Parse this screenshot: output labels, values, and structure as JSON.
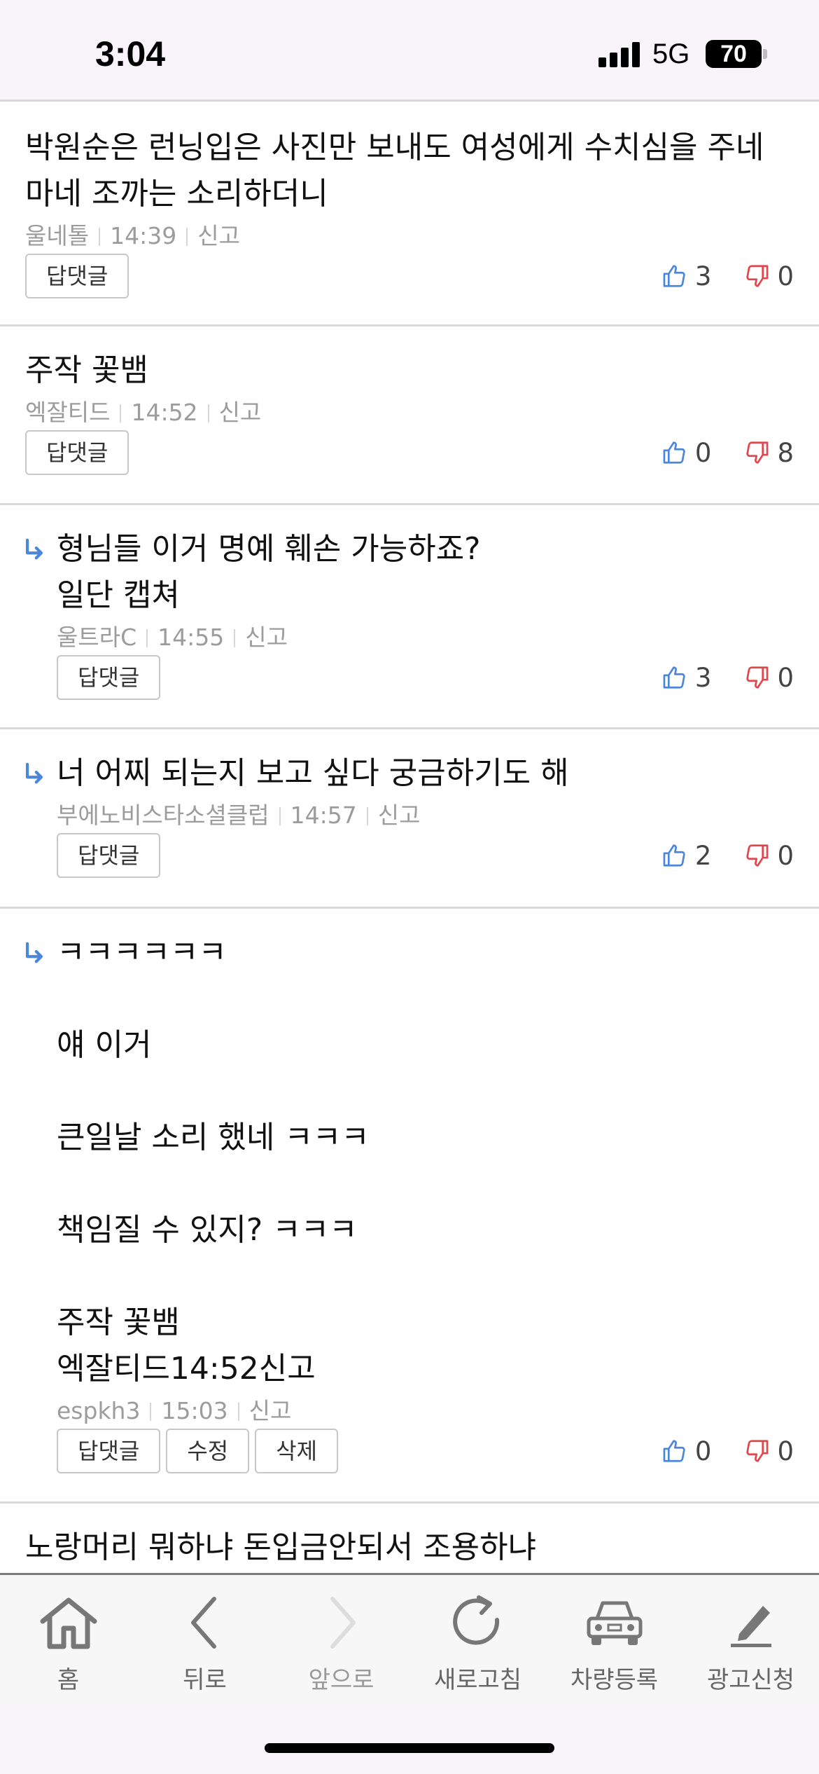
{
  "status": {
    "time": "3:04",
    "network": "5G",
    "battery": "70"
  },
  "comments": [
    {
      "body": "박원순은 런닝입은 사진만 보내도 여성에게 수치심을 주네\n마네 조까는 소리하더니",
      "author": "울네톨",
      "time": "14:39",
      "report": "신고",
      "buttons": [
        "답댓글"
      ],
      "up": "3",
      "down": "0",
      "reply": false
    },
    {
      "body": "주작 꽃뱀",
      "author": "엑잘티드",
      "time": "14:52",
      "report": "신고",
      "buttons": [
        "답댓글"
      ],
      "up": "0",
      "down": "8",
      "reply": false
    },
    {
      "body": "형님들 이거 명예 훼손 가능하죠?\n일단 캡쳐",
      "author": "울트라C",
      "time": "14:55",
      "report": "신고",
      "buttons": [
        "답댓글"
      ],
      "up": "3",
      "down": "0",
      "reply": true
    },
    {
      "body": "너 어찌 되는지 보고 싶다 궁금하기도 해",
      "author": "부에노비스타소셜클럽",
      "time": "14:57",
      "report": "신고",
      "buttons": [
        "답댓글"
      ],
      "up": "2",
      "down": "0",
      "reply": true
    },
    {
      "body": "ㅋㅋㅋㅋㅋㅋ\n\n얘 이거\n\n큰일날 소리 했네 ㅋㅋㅋ\n\n책임질 수 있지? ㅋㅋㅋ\n\n주작 꽃뱀\n엑잘티드14:52신고",
      "author": "espkh3",
      "time": "15:03",
      "report": "신고",
      "buttons": [
        "답댓글",
        "수정",
        "삭제"
      ],
      "up": "0",
      "down": "0",
      "reply": true
    },
    {
      "body": "노랑머리 뭐하냐 돈입금안되서 조용하냐",
      "reply": false,
      "partial": true
    }
  ],
  "nav": [
    {
      "label": "홈",
      "icon": "home-icon"
    },
    {
      "label": "뒤로",
      "icon": "back-arrow-icon"
    },
    {
      "label": "앞으로",
      "icon": "forward-arrow-icon",
      "disabled": true
    },
    {
      "label": "새로고침",
      "icon": "refresh-icon"
    },
    {
      "label": "차량등록",
      "icon": "car-icon"
    },
    {
      "label": "광고신청",
      "icon": "pencil-icon"
    }
  ],
  "colors": {
    "thumb_up": "#4a86d9",
    "thumb_down": "#e0474c",
    "reply_arrow": "#4a86d9",
    "nav_icon": "#777777",
    "nav_icon_disabled": "#dddddd"
  }
}
